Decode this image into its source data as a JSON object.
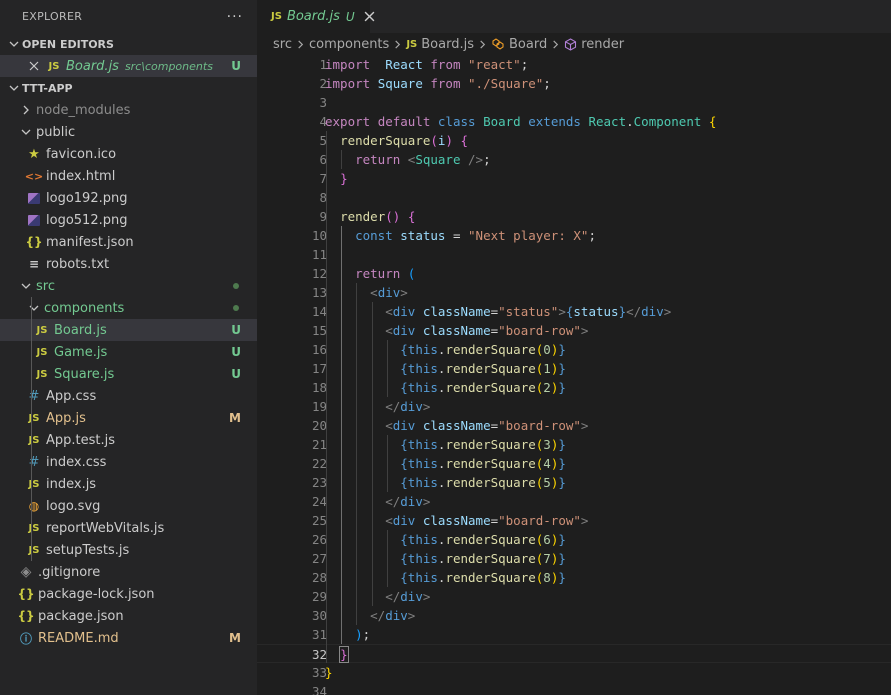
{
  "explorer": {
    "title": "EXPLORER",
    "more_label": "···",
    "open_editors": {
      "label": "OPEN EDITORS",
      "items": [
        {
          "name": "Board.js",
          "path": "src\\components",
          "badge": "U"
        }
      ]
    },
    "project": {
      "label": "TTT-APP",
      "items": [
        {
          "name": "node_modules",
          "type": "folder",
          "depth": 1,
          "expanded": false,
          "state": "ignored"
        },
        {
          "name": "public",
          "type": "folder",
          "depth": 1,
          "expanded": true
        },
        {
          "name": "favicon.ico",
          "type": "file",
          "icon": "favicon",
          "depth": 2
        },
        {
          "name": "index.html",
          "type": "file",
          "icon": "html",
          "depth": 2
        },
        {
          "name": "logo192.png",
          "type": "file",
          "icon": "image",
          "depth": 2
        },
        {
          "name": "logo512.png",
          "type": "file",
          "icon": "image",
          "depth": 2
        },
        {
          "name": "manifest.json",
          "type": "file",
          "icon": "json",
          "depth": 2
        },
        {
          "name": "robots.txt",
          "type": "file",
          "icon": "text",
          "depth": 2
        },
        {
          "name": "src",
          "type": "folder",
          "depth": 1,
          "expanded": true,
          "state": "untracked",
          "dot": true
        },
        {
          "name": "components",
          "type": "folder",
          "depth": 2,
          "expanded": true,
          "state": "untracked",
          "dot": true
        },
        {
          "name": "Board.js",
          "type": "file",
          "icon": "js",
          "depth": 3,
          "state": "untracked",
          "badge": "U",
          "selected": true
        },
        {
          "name": "Game.js",
          "type": "file",
          "icon": "js",
          "depth": 3,
          "state": "untracked",
          "badge": "U"
        },
        {
          "name": "Square.js",
          "type": "file",
          "icon": "js",
          "depth": 3,
          "state": "untracked",
          "badge": "U"
        },
        {
          "name": "App.css",
          "type": "file",
          "icon": "css",
          "depth": 2
        },
        {
          "name": "App.js",
          "type": "file",
          "icon": "js",
          "depth": 2,
          "state": "modified",
          "badge": "M"
        },
        {
          "name": "App.test.js",
          "type": "file",
          "icon": "js",
          "depth": 2
        },
        {
          "name": "index.css",
          "type": "file",
          "icon": "css",
          "depth": 2
        },
        {
          "name": "index.js",
          "type": "file",
          "icon": "js",
          "depth": 2
        },
        {
          "name": "logo.svg",
          "type": "file",
          "icon": "svg",
          "depth": 2
        },
        {
          "name": "reportWebVitals.js",
          "type": "file",
          "icon": "js",
          "depth": 2
        },
        {
          "name": "setupTests.js",
          "type": "file",
          "icon": "js",
          "depth": 2
        },
        {
          "name": ".gitignore",
          "type": "file",
          "icon": "git",
          "depth": 1
        },
        {
          "name": "package-lock.json",
          "type": "file",
          "icon": "json",
          "depth": 1
        },
        {
          "name": "package.json",
          "type": "file",
          "icon": "json",
          "depth": 1
        },
        {
          "name": "README.md",
          "type": "file",
          "icon": "info",
          "depth": 1,
          "state": "modified",
          "badge": "M"
        }
      ]
    }
  },
  "icons": {
    "js": "JS",
    "html": "<>",
    "css": "#",
    "json": "{}",
    "favicon": "★",
    "text": "≡",
    "svg": "◍",
    "git": "◈",
    "info": "ⓘ"
  },
  "editor": {
    "tab": {
      "icon": "JS",
      "label": "Board.js",
      "badge": "U"
    },
    "breadcrumb": [
      "src",
      "components",
      "Board.js",
      "Board",
      "render"
    ],
    "current_line": 32,
    "lines": [
      [
        [
          "k",
          "import"
        ],
        [
          "",
          "  "
        ],
        [
          "v",
          "React"
        ],
        [
          "",
          " "
        ],
        [
          "k",
          "from"
        ],
        [
          "",
          " "
        ],
        [
          "s",
          "\"react\""
        ],
        [
          "",
          ";"
        ]
      ],
      [
        [
          "k",
          "import"
        ],
        [
          "",
          " "
        ],
        [
          "v",
          "Square"
        ],
        [
          "",
          " "
        ],
        [
          "k",
          "from"
        ],
        [
          "",
          " "
        ],
        [
          "s",
          "\"./Square\""
        ],
        [
          "",
          ";"
        ]
      ],
      [],
      [
        [
          "k",
          "export"
        ],
        [
          "",
          " "
        ],
        [
          "k",
          "default"
        ],
        [
          "",
          " "
        ],
        [
          "kb",
          "class"
        ],
        [
          "",
          " "
        ],
        [
          "c",
          "Board"
        ],
        [
          "",
          " "
        ],
        [
          "kb",
          "extends"
        ],
        [
          "",
          " "
        ],
        [
          "c",
          "React"
        ],
        [
          "",
          "."
        ],
        [
          "c",
          "Component"
        ],
        [
          "",
          " "
        ],
        [
          "y",
          "{"
        ]
      ],
      [
        [
          "",
          "  "
        ],
        [
          "f",
          "renderSquare"
        ],
        [
          "p",
          "("
        ],
        [
          "v",
          "i"
        ],
        [
          "p",
          ")"
        ],
        [
          "",
          " "
        ],
        [
          "p",
          "{"
        ]
      ],
      [
        [
          "",
          "    "
        ],
        [
          "k",
          "return"
        ],
        [
          "",
          " "
        ],
        [
          "tg",
          "<"
        ],
        [
          "c",
          "Square"
        ],
        [
          "",
          " "
        ],
        [
          "tg",
          "/>"
        ],
        [
          "",
          ";"
        ]
      ],
      [
        [
          "",
          "  "
        ],
        [
          "p",
          "}"
        ]
      ],
      [],
      [
        [
          "",
          "  "
        ],
        [
          "f",
          "render"
        ],
        [
          "p",
          "()"
        ],
        [
          "",
          " "
        ],
        [
          "p",
          "{"
        ]
      ],
      [
        [
          "",
          "    "
        ],
        [
          "kb",
          "const"
        ],
        [
          "",
          " "
        ],
        [
          "v",
          "status"
        ],
        [
          "",
          " = "
        ],
        [
          "s",
          "\"Next player: X\""
        ],
        [
          "",
          ";"
        ]
      ],
      [],
      [
        [
          "",
          "    "
        ],
        [
          "k",
          "return"
        ],
        [
          "",
          " "
        ],
        [
          "b",
          "("
        ]
      ],
      [
        [
          "",
          "      "
        ],
        [
          "tg",
          "<"
        ],
        [
          "t",
          "div"
        ],
        [
          "tg",
          ">"
        ]
      ],
      [
        [
          "",
          "        "
        ],
        [
          "tg",
          "<"
        ],
        [
          "t",
          "div"
        ],
        [
          "",
          " "
        ],
        [
          "v",
          "className"
        ],
        [
          "",
          "="
        ],
        [
          "s",
          "\"status\""
        ],
        [
          "tg",
          ">"
        ],
        [
          "kb",
          "{"
        ],
        [
          "v",
          "status"
        ],
        [
          "kb",
          "}"
        ],
        [
          "tg",
          "</"
        ],
        [
          "t",
          "div"
        ],
        [
          "tg",
          ">"
        ]
      ],
      [
        [
          "",
          "        "
        ],
        [
          "tg",
          "<"
        ],
        [
          "t",
          "div"
        ],
        [
          "",
          " "
        ],
        [
          "v",
          "className"
        ],
        [
          "",
          "="
        ],
        [
          "s",
          "\"board-row\""
        ],
        [
          "tg",
          ">"
        ]
      ],
      [
        [
          "",
          "          "
        ],
        [
          "kb",
          "{"
        ],
        [
          "kb",
          "this"
        ],
        [
          "",
          "."
        ],
        [
          "f",
          "renderSquare"
        ],
        [
          "y",
          "("
        ],
        [
          "n",
          "0"
        ],
        [
          "y",
          ")"
        ],
        [
          "kb",
          "}"
        ]
      ],
      [
        [
          "",
          "          "
        ],
        [
          "kb",
          "{"
        ],
        [
          "kb",
          "this"
        ],
        [
          "",
          "."
        ],
        [
          "f",
          "renderSquare"
        ],
        [
          "y",
          "("
        ],
        [
          "n",
          "1"
        ],
        [
          "y",
          ")"
        ],
        [
          "kb",
          "}"
        ]
      ],
      [
        [
          "",
          "          "
        ],
        [
          "kb",
          "{"
        ],
        [
          "kb",
          "this"
        ],
        [
          "",
          "."
        ],
        [
          "f",
          "renderSquare"
        ],
        [
          "y",
          "("
        ],
        [
          "n",
          "2"
        ],
        [
          "y",
          ")"
        ],
        [
          "kb",
          "}"
        ]
      ],
      [
        [
          "",
          "        "
        ],
        [
          "tg",
          "</"
        ],
        [
          "t",
          "div"
        ],
        [
          "tg",
          ">"
        ]
      ],
      [
        [
          "",
          "        "
        ],
        [
          "tg",
          "<"
        ],
        [
          "t",
          "div"
        ],
        [
          "",
          " "
        ],
        [
          "v",
          "className"
        ],
        [
          "",
          "="
        ],
        [
          "s",
          "\"board-row\""
        ],
        [
          "tg",
          ">"
        ]
      ],
      [
        [
          "",
          "          "
        ],
        [
          "kb",
          "{"
        ],
        [
          "kb",
          "this"
        ],
        [
          "",
          "."
        ],
        [
          "f",
          "renderSquare"
        ],
        [
          "y",
          "("
        ],
        [
          "n",
          "3"
        ],
        [
          "y",
          ")"
        ],
        [
          "kb",
          "}"
        ]
      ],
      [
        [
          "",
          "          "
        ],
        [
          "kb",
          "{"
        ],
        [
          "kb",
          "this"
        ],
        [
          "",
          "."
        ],
        [
          "f",
          "renderSquare"
        ],
        [
          "y",
          "("
        ],
        [
          "n",
          "4"
        ],
        [
          "y",
          ")"
        ],
        [
          "kb",
          "}"
        ]
      ],
      [
        [
          "",
          "          "
        ],
        [
          "kb",
          "{"
        ],
        [
          "kb",
          "this"
        ],
        [
          "",
          "."
        ],
        [
          "f",
          "renderSquare"
        ],
        [
          "y",
          "("
        ],
        [
          "n",
          "5"
        ],
        [
          "y",
          ")"
        ],
        [
          "kb",
          "}"
        ]
      ],
      [
        [
          "",
          "        "
        ],
        [
          "tg",
          "</"
        ],
        [
          "t",
          "div"
        ],
        [
          "tg",
          ">"
        ]
      ],
      [
        [
          "",
          "        "
        ],
        [
          "tg",
          "<"
        ],
        [
          "t",
          "div"
        ],
        [
          "",
          " "
        ],
        [
          "v",
          "className"
        ],
        [
          "",
          "="
        ],
        [
          "s",
          "\"board-row\""
        ],
        [
          "tg",
          ">"
        ]
      ],
      [
        [
          "",
          "          "
        ],
        [
          "kb",
          "{"
        ],
        [
          "kb",
          "this"
        ],
        [
          "",
          "."
        ],
        [
          "f",
          "renderSquare"
        ],
        [
          "y",
          "("
        ],
        [
          "n",
          "6"
        ],
        [
          "y",
          ")"
        ],
        [
          "kb",
          "}"
        ]
      ],
      [
        [
          "",
          "          "
        ],
        [
          "kb",
          "{"
        ],
        [
          "kb",
          "this"
        ],
        [
          "",
          "."
        ],
        [
          "f",
          "renderSquare"
        ],
        [
          "y",
          "("
        ],
        [
          "n",
          "7"
        ],
        [
          "y",
          ")"
        ],
        [
          "kb",
          "}"
        ]
      ],
      [
        [
          "",
          "          "
        ],
        [
          "kb",
          "{"
        ],
        [
          "kb",
          "this"
        ],
        [
          "",
          "."
        ],
        [
          "f",
          "renderSquare"
        ],
        [
          "y",
          "("
        ],
        [
          "n",
          "8"
        ],
        [
          "y",
          ")"
        ],
        [
          "kb",
          "}"
        ]
      ],
      [
        [
          "",
          "        "
        ],
        [
          "tg",
          "</"
        ],
        [
          "t",
          "div"
        ],
        [
          "tg",
          ">"
        ]
      ],
      [
        [
          "",
          "      "
        ],
        [
          "tg",
          "</"
        ],
        [
          "t",
          "div"
        ],
        [
          "tg",
          ">"
        ]
      ],
      [
        [
          "",
          "    "
        ],
        [
          "b",
          ")"
        ],
        [
          "",
          ";"
        ]
      ],
      [
        [
          "",
          "  "
        ],
        [
          "p",
          "}"
        ]
      ],
      [
        [
          "y",
          "}"
        ]
      ],
      []
    ]
  },
  "colors": {
    "sidebar_bg": "#252526",
    "editor_bg": "#1e1e1e",
    "untracked": "#73c991",
    "modified": "#e2c08d",
    "selection": "#37373d"
  }
}
